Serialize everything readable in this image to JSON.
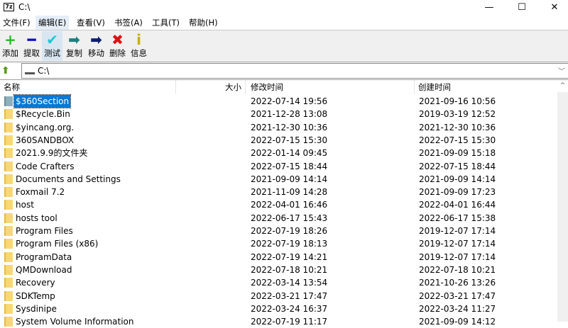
{
  "window": {
    "title": "C:\\",
    "logo": "7z",
    "minimize": "—",
    "maximize": "☐",
    "close": "✕"
  },
  "menu": [
    "文件(F)",
    "编辑(E)",
    "查看(V)",
    "书签(A)",
    "工具(T)",
    "帮助(H)"
  ],
  "toolbar": [
    {
      "label": "添加",
      "icon": "+",
      "color": "#1fc01f"
    },
    {
      "label": "提取",
      "icon": "━",
      "color": "#1010c0"
    },
    {
      "label": "测试",
      "icon": "✔",
      "color": "#20c8d0"
    },
    {
      "label": "复制",
      "icon": "➡",
      "color": "#208080"
    },
    {
      "label": "移动",
      "icon": "➡",
      "color": "#102070"
    },
    {
      "label": "删除",
      "icon": "✖",
      "color": "#e01010"
    },
    {
      "label": "信息",
      "icon": "i",
      "color": "#c8b000"
    }
  ],
  "address": {
    "path": "C:\\"
  },
  "columns": {
    "name": "名称",
    "size": "大小",
    "modified": "修改时间",
    "created": "创建时间"
  },
  "rows": [
    {
      "name": "$360Section",
      "modified": "2022-07-14 19:56",
      "created": "2021-09-16 10:56"
    },
    {
      "name": "$Recycle.Bin",
      "modified": "2021-12-28 13:08",
      "created": "2019-03-19 12:52"
    },
    {
      "name": "$yincang.org.",
      "modified": "2021-12-30 10:36",
      "created": "2021-12-30 10:36"
    },
    {
      "name": "360SANDBOX",
      "modified": "2022-07-15 15:30",
      "created": "2022-07-15 15:30"
    },
    {
      "name": "2021.9.9的文件夹",
      "modified": "2022-01-14 09:45",
      "created": "2021-09-09 15:18"
    },
    {
      "name": "Code Crafters",
      "modified": "2022-07-15 18:44",
      "created": "2022-07-15 18:44"
    },
    {
      "name": "Documents and Settings",
      "modified": "2021-09-09 14:14",
      "created": "2021-09-09 14:14"
    },
    {
      "name": "Foxmail 7.2",
      "modified": "2021-11-09 14:28",
      "created": "2021-09-09 17:23"
    },
    {
      "name": "host",
      "modified": "2022-04-01 16:46",
      "created": "2022-04-01 16:44"
    },
    {
      "name": "hosts tool",
      "modified": "2022-06-17 15:43",
      "created": "2022-06-17 15:38"
    },
    {
      "name": "Program Files",
      "modified": "2022-07-19 18:26",
      "created": "2019-12-07 17:14"
    },
    {
      "name": "Program Files (x86)",
      "modified": "2022-07-19 18:13",
      "created": "2019-12-07 17:14"
    },
    {
      "name": "ProgramData",
      "modified": "2022-07-19 14:21",
      "created": "2019-12-07 17:14"
    },
    {
      "name": "QMDownload",
      "modified": "2022-07-18 10:21",
      "created": "2022-07-18 10:21"
    },
    {
      "name": "Recovery",
      "modified": "2022-03-14 13:54",
      "created": "2021-10-26 13:26"
    },
    {
      "name": "SDKTemp",
      "modified": "2022-03-21 17:47",
      "created": "2022-03-21 17:47"
    },
    {
      "name": "Sysdinipe",
      "modified": "2022-03-24 16:37",
      "created": "2022-03-24 11:27"
    },
    {
      "name": "System Volume Information",
      "modified": "2022-07-19 11:17",
      "created": "2021-09-09 14:12"
    }
  ],
  "scrollbar": {
    "up_arrow": "^"
  }
}
